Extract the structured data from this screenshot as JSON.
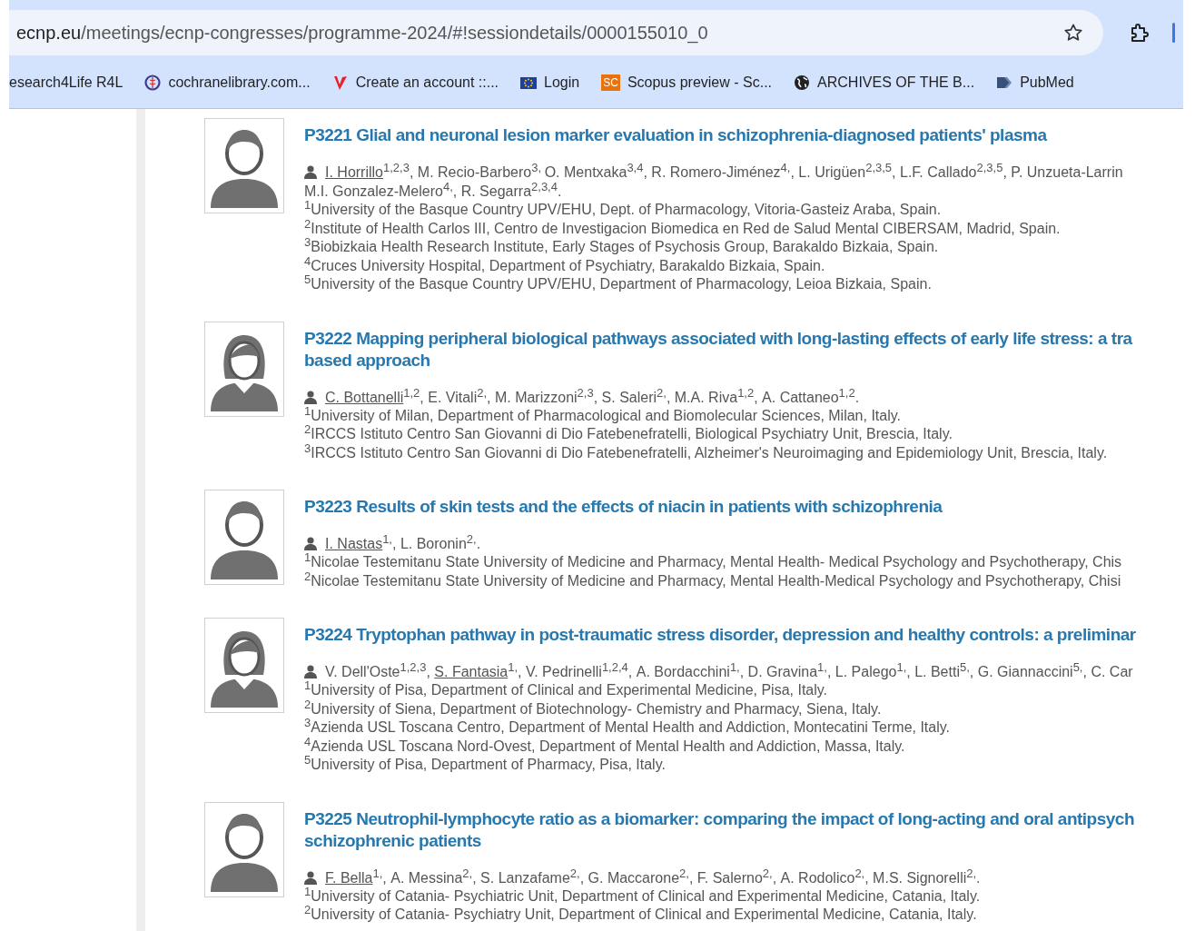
{
  "browser": {
    "url_domain": "ecnp.eu",
    "url_path": "/meetings/ecnp-congresses/programme-2024/#!sessiondetails/0000155010_0",
    "bookmarks": [
      {
        "label": "esearch4Life R4L",
        "kind": "none"
      },
      {
        "label": "cochranelibrary.com...",
        "kind": "cochrane"
      },
      {
        "label": "Create an account ::...",
        "kind": "v"
      },
      {
        "label": "Login",
        "kind": "eu"
      },
      {
        "label": "Scopus preview - Sc...",
        "kind": "sc",
        "icon_text": "SC"
      },
      {
        "label": "ARCHIVES OF THE B...",
        "kind": "globe"
      },
      {
        "label": "PubMed",
        "kind": "pubmed"
      }
    ]
  },
  "posters": [
    {
      "avatar": {
        "kind": "male"
      },
      "title_lines": [
        "P3221 Glial and neuronal lesion marker evaluation in schizophrenia-diagnosed patients' plasma"
      ],
      "author_lines": [
        [
          {
            "name": "I. Horrillo",
            "affil": "1,2,3",
            "after": ", ",
            "presenter": true
          },
          {
            "name": "M. Recio-Barbero",
            "affil": "3, ",
            "presenter": false
          },
          {
            "name": "O. Mentxaka",
            "affil": "3,4",
            "after": ", ",
            "presenter": false
          },
          {
            "name": "R. Romero-Jiménez",
            "affil": "4,",
            "after": ", ",
            "presenter": false
          },
          {
            "name": "L. Urigüen",
            "affil": "2,3,5",
            "after": ", ",
            "presenter": false
          },
          {
            "name": "L.F. Callado",
            "affil": "2,3,5",
            "after": ", ",
            "presenter": false
          },
          {
            "name": "P. Unzueta-Larrin",
            "presenter": false
          }
        ],
        [
          {
            "name": "M.I. Gonzalez-Melero",
            "affil": "4,",
            "after": ", ",
            "presenter": false
          },
          {
            "name": "R. Segarra",
            "affil": "2,3,4",
            "after": ".",
            "presenter": false
          }
        ]
      ],
      "affiliations": [
        {
          "num": "1",
          "text": "University of the Basque Country UPV/EHU, Dept. of Pharmacology, Vitoria-Gasteiz Araba, Spain."
        },
        {
          "num": "2",
          "text": "Institute of Health Carlos III, Centro de Investigacion Biomedica en Red de Salud Mental CIBERSAM, Madrid, Spain."
        },
        {
          "num": "3",
          "text": "Biobizkaia Health Research Institute, Early Stages of Psychosis Group, Barakaldo Bizkaia, Spain."
        },
        {
          "num": "4",
          "text": "Cruces University Hospital, Department of Psychiatry, Barakaldo Bizkaia, Spain."
        },
        {
          "num": "5",
          "text": "University of the Basque Country UPV/EHU, Department of Pharmacology, Leioa Bizkaia, Spain."
        }
      ]
    },
    {
      "avatar": {
        "kind": "female"
      },
      "title_lines": [
        "P3222 Mapping peripheral biological pathways associated with long-lasting effects of early life stress: a tra",
        "based approach"
      ],
      "author_lines": [
        [
          {
            "name": "C. Bottanelli",
            "affil": "1,2",
            "after": ", ",
            "presenter": true
          },
          {
            "name": "E. Vitali",
            "affil": "2,",
            "after": ", ",
            "presenter": false
          },
          {
            "name": "M. Marizzoni",
            "affil": "2,3",
            "after": ", ",
            "presenter": false
          },
          {
            "name": "S. Saleri",
            "affil": "2,",
            "after": ", ",
            "presenter": false
          },
          {
            "name": "M.A. Riva",
            "affil": "1,2",
            "after": ", ",
            "presenter": false
          },
          {
            "name": "A. Cattaneo",
            "affil": "1,2",
            "after": ".",
            "presenter": false
          }
        ]
      ],
      "affiliations": [
        {
          "num": "1",
          "text": "University of Milan, Department of Pharmacological and Biomolecular Sciences, Milan, Italy."
        },
        {
          "num": "2",
          "text": "IRCCS Istituto Centro San Giovanni di Dio Fatebenefratelli, Biological Psychiatry Unit, Brescia, Italy."
        },
        {
          "num": "3",
          "text": "IRCCS Istituto Centro San Giovanni di Dio Fatebenefratelli, Alzheimer's Neuroimaging and Epidemiology Unit, Brescia, Italy."
        }
      ]
    },
    {
      "avatar": {
        "kind": "male"
      },
      "title_lines": [
        "P3223 Results of skin tests and the effects of niacin in patients with schizophrenia"
      ],
      "author_lines": [
        [
          {
            "name": "I. Nastas",
            "affil": "1,",
            "after": ", ",
            "presenter": true
          },
          {
            "name": "L. Boronin",
            "affil": "2,",
            "after": ".",
            "presenter": false
          }
        ]
      ],
      "affiliations": [
        {
          "num": "1",
          "text": "Nicolae Testemitanu State University of Medicine and Pharmacy, Mental Health- Medical Psychology and Psychotherapy, Chis"
        },
        {
          "num": "2",
          "text": "Nicolae Testemitanu State University of Medicine and Pharmacy, Mental Health-Medical Psychology and Psychotherapy, Chisi"
        }
      ]
    },
    {
      "avatar": {
        "kind": "female"
      },
      "title_lines": [
        "P3224 Tryptophan pathway in post-traumatic stress disorder, depression and healthy controls: a preliminar"
      ],
      "author_lines": [
        [
          {
            "name": "V. Dell'Oste",
            "affil": "1,2,3",
            "after": ", ",
            "presenter": false
          },
          {
            "name": "S. Fantasia",
            "affil": "1,",
            "after": ", ",
            "presenter": true
          },
          {
            "name": "V. Pedrinelli",
            "affil": "1,2,4",
            "after": ", ",
            "presenter": false
          },
          {
            "name": "A. Bordacchini",
            "affil": "1,",
            "after": ", ",
            "presenter": false
          },
          {
            "name": "D. Gravina",
            "affil": "1,",
            "after": ", ",
            "presenter": false
          },
          {
            "name": "L. Palego",
            "affil": "1,",
            "after": ", ",
            "presenter": false
          },
          {
            "name": "L. Betti",
            "affil": "5,",
            "after": ", ",
            "presenter": false
          },
          {
            "name": "G. Giannaccini",
            "affil": "5,",
            "after": ", ",
            "presenter": false
          },
          {
            "name": "C. Car",
            "presenter": false
          }
        ]
      ],
      "affiliations": [
        {
          "num": "1",
          "text": "University of Pisa, Department of Clinical and Experimental Medicine, Pisa, Italy."
        },
        {
          "num": "2",
          "text": "University of Siena, Department of Biotechnology- Chemistry and Pharmacy, Siena, Italy."
        },
        {
          "num": "3",
          "text": "Azienda USL Toscana Centro, Department of Mental Health and Addiction, Montecatini Terme, Italy."
        },
        {
          "num": "4",
          "text": "Azienda USL Toscana Nord-Ovest, Department of Mental Health and Addiction, Massa, Italy."
        },
        {
          "num": "5",
          "text": "University of Pisa, Department of Pharmacy, Pisa, Italy."
        }
      ]
    },
    {
      "avatar": {
        "kind": "male"
      },
      "title_lines": [
        "P3225 Neutrophil-lymphocyte ratio as a biomarker: comparing the impact of long-acting and oral antipsych",
        "schizophrenic patients"
      ],
      "author_lines": [
        [
          {
            "name": "F. Bella",
            "affil": "1,",
            "after": ", ",
            "presenter": true
          },
          {
            "name": "A. Messina",
            "affil": "2,",
            "after": ", ",
            "presenter": false
          },
          {
            "name": "S. Lanzafame",
            "affil": "2,",
            "after": ", ",
            "presenter": false
          },
          {
            "name": "G. Maccarone",
            "affil": "2,",
            "after": ", ",
            "presenter": false
          },
          {
            "name": "F. Salerno",
            "affil": "2,",
            "after": ", ",
            "presenter": false
          },
          {
            "name": "A. Rodolico",
            "affil": "2,",
            "after": ", ",
            "presenter": false
          },
          {
            "name": "M.S. Signorelli",
            "affil": "2,",
            "after": ".",
            "presenter": false
          }
        ]
      ],
      "affiliations": [
        {
          "num": "1",
          "text": "University of Catania- Psychiatric Unit, Department of Clinical and Experimental Medicine, Catania, Italy."
        },
        {
          "num": "2",
          "text": "University of Catania- Psychiatry Unit, Department of Clinical and Experimental Medicine, Catania, Italy."
        }
      ]
    }
  ]
}
